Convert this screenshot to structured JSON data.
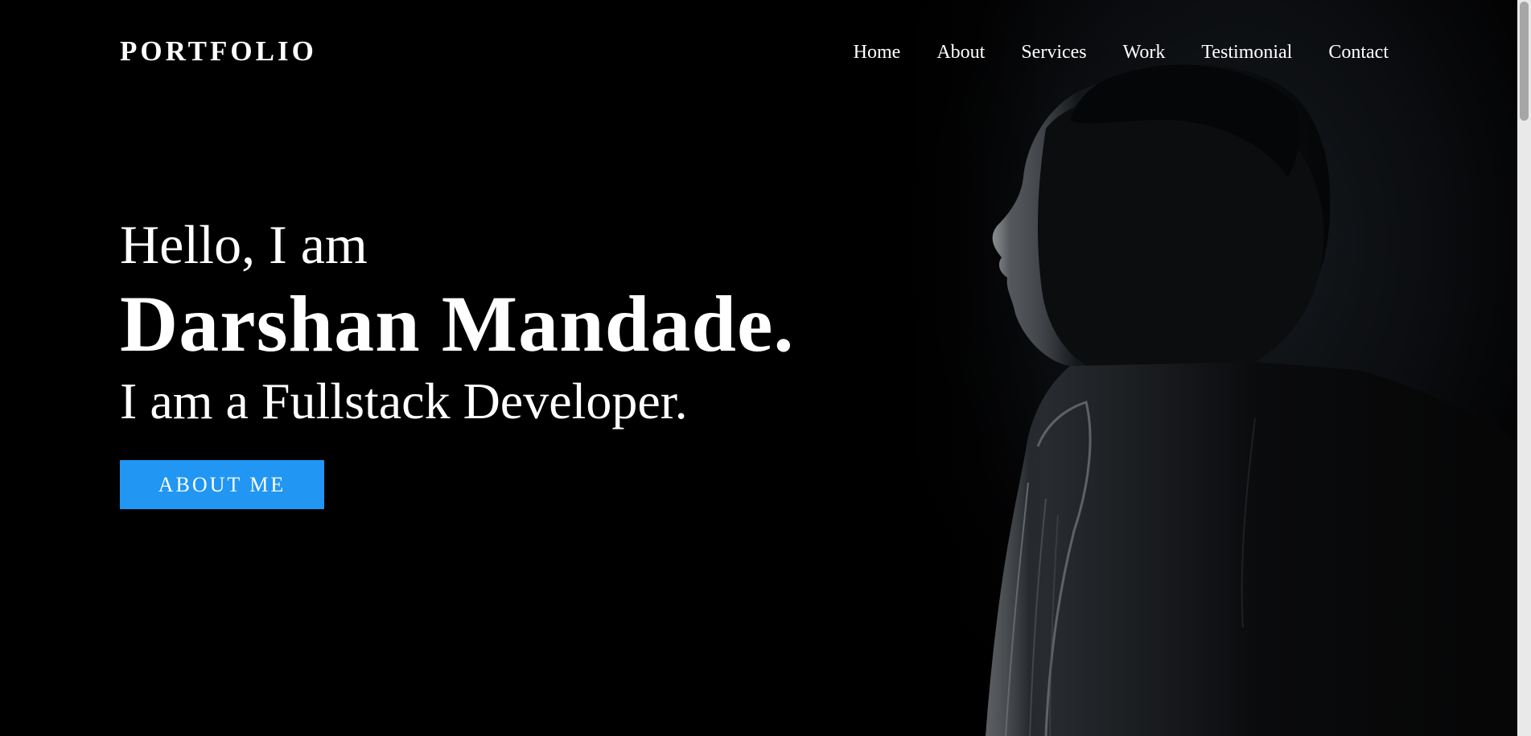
{
  "header": {
    "logo": "PORTFOLIO",
    "nav": [
      {
        "label": "Home"
      },
      {
        "label": "About"
      },
      {
        "label": "Services"
      },
      {
        "label": "Work"
      },
      {
        "label": "Testimonial"
      },
      {
        "label": "Contact"
      }
    ]
  },
  "hero": {
    "greeting": "Hello, I am",
    "name": "Darshan Mandade.",
    "role": "I am a Fullstack Developer.",
    "cta_label": "ABOUT ME"
  },
  "colors": {
    "background": "#000000",
    "accent": "#2196f3",
    "text": "#ffffff"
  }
}
